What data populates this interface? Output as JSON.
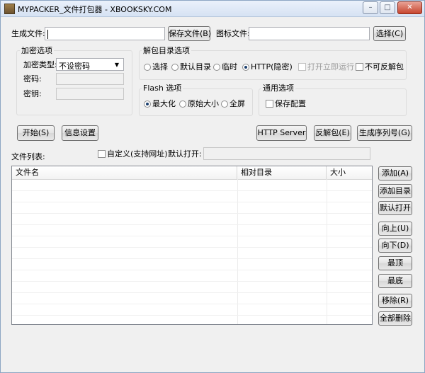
{
  "window": {
    "title": "MYPACKER_文件打包器 - XBOOKSKY.COM",
    "minimize_icon": "minimize-icon",
    "maximize_icon": "maximize-icon",
    "close_icon": "close-icon",
    "minimize_glyph": "–",
    "maximize_glyph": "□",
    "close_glyph": "✕"
  },
  "top": {
    "output_label": "生成文件:",
    "output_value": "",
    "save_file_button": "保存文件(B)",
    "icon_label": "图标文件:",
    "icon_value": "",
    "choose_button": "选择(C)"
  },
  "encryption": {
    "title": "加密选项",
    "type_label": "加密类型:",
    "type_value": "不设密码",
    "password_label": "密码:",
    "key_label": "密钥:"
  },
  "unpack": {
    "title": "解包目录选项",
    "options": [
      "选择",
      "默认目录",
      "临时",
      "HTTP(隐密)"
    ],
    "selected": "HTTP(隐密)",
    "run_after": "打开立即运行",
    "no_reverse": "不可反解包"
  },
  "flash": {
    "title": "Flash 选项",
    "options": [
      "最大化",
      "原始大小",
      "全屏"
    ],
    "selected": "最大化"
  },
  "general": {
    "title": "通用选项",
    "save_config": "保存配置"
  },
  "actions": {
    "start": "开始(S)",
    "info_settings": "信息设置",
    "http_server": "HTTP Server",
    "unpack": "反解包(E)",
    "gen_serial": "生成序列号(G)"
  },
  "filelist": {
    "label": "文件列表:",
    "custom_label": "自定义(支持网址)",
    "default_open_label": "默认打开:",
    "default_open_value": "",
    "columns": [
      "文件名",
      "相对目录",
      "大小"
    ],
    "rows": []
  },
  "side_buttons": [
    "添加(A)",
    "添加目录",
    "默认打开",
    "向上(U)",
    "向下(D)",
    "最顶",
    "最底",
    "移除(R)",
    "全部删除"
  ]
}
